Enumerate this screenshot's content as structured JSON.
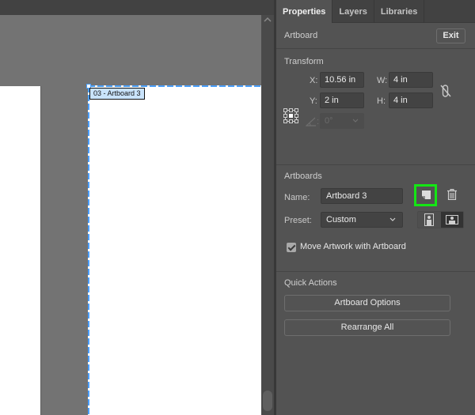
{
  "canvas": {
    "artboard_label": "03 - Artboard 3",
    "scroll_up_icon": "chevron-up-icon"
  },
  "panel": {
    "tabs": [
      {
        "label": "Properties",
        "active": true
      },
      {
        "label": "Layers",
        "active": false
      },
      {
        "label": "Libraries",
        "active": false
      }
    ],
    "artboard": {
      "title": "Artboard",
      "exit_label": "Exit"
    },
    "transform": {
      "title": "Transform",
      "x_label": "X:",
      "x_value": "10.56 in",
      "y_label": "Y:",
      "y_value": "2 in",
      "w_label": "W:",
      "w_value": "4 in",
      "h_label": "H:",
      "h_value": "4 in",
      "angle_label": ":",
      "angle_value": "0°",
      "reference_icon": "reference-point-icon",
      "link_icon": "unlinked-proportions-icon"
    },
    "artboards": {
      "title": "Artboards",
      "name_label": "Name:",
      "name_value": "Artboard 3",
      "preset_label": "Preset:",
      "preset_value": "Custom",
      "move_artwork_label": "Move Artwork with Artboard",
      "move_artwork_checked": true,
      "highlight_color": "#14e614"
    },
    "quick_actions": {
      "title": "Quick Actions",
      "artboard_options_label": "Artboard Options",
      "rearrange_all_label": "Rearrange All"
    }
  },
  "colors": {
    "selection": "#4a9fff",
    "panel_bg": "#535353",
    "canvas_bg": "#737373",
    "highlight": "#14e614"
  }
}
